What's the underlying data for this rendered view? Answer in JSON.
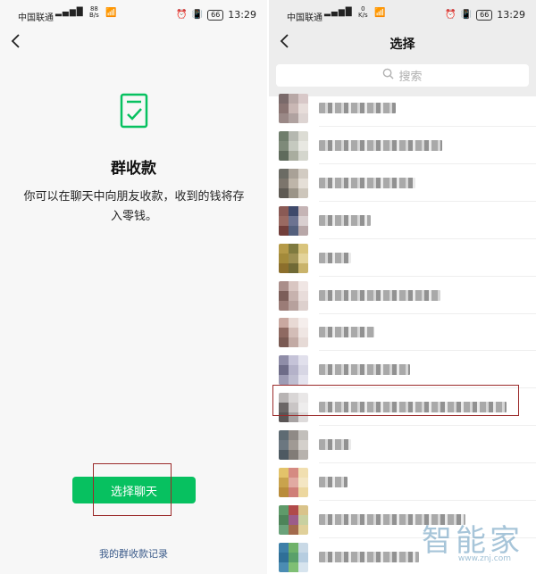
{
  "status_bar": {
    "carrier": "中国联通",
    "net_speed_left": "88",
    "net_speed_right": "0",
    "net_speed_unit": "B/s",
    "net_speed_unit_right": "K/s",
    "battery": "66",
    "time": "13:29"
  },
  "left": {
    "title": "群收款",
    "description": "你可以在聊天中向朋友收款，收到的钱将存入零钱。",
    "primary_button": "选择聊天",
    "records_link": "我的群收款记录",
    "accent_color": "#07c160"
  },
  "right": {
    "title": "选择",
    "search_placeholder": "搜索",
    "rows": [
      {
        "avatar": [
          "#7a6a6a",
          "#b8a8a6",
          "#d8c8c8",
          "#8a7472",
          "#c9b7b4",
          "#e7ddda",
          "#9a8886",
          "#b0a2a0",
          "#ddd4d2"
        ]
      },
      {
        "avatar": [
          "#6f7d6c",
          "#b5b8b0",
          "#dcdcd4",
          "#7e8a79",
          "#c5c9bf",
          "#e8e8e2",
          "#5f6b5c",
          "#a9ad9f",
          "#d4d6cd"
        ]
      },
      {
        "avatar": [
          "#6b6b64",
          "#a9a197",
          "#d2cbc2",
          "#7c756c",
          "#beb5a9",
          "#e5dfd7",
          "#5e5a53",
          "#9b9488",
          "#cdc6bb"
        ]
      },
      {
        "avatar": [
          "#8a5a55",
          "#3f4a6b",
          "#c5b4b5",
          "#9a6a62",
          "#6c7391",
          "#d9cfd0",
          "#723f3b",
          "#54607d",
          "#b8a7a8"
        ]
      },
      {
        "avatar": [
          "#b59a48",
          "#7f7a3f",
          "#d9c47c",
          "#a38a3a",
          "#9c8f52",
          "#e3d39a",
          "#8c6f2c",
          "#706a36",
          "#c9b36b"
        ]
      },
      {
        "avatar": [
          "#aa8e8a",
          "#d9c6c2",
          "#f0e6e4",
          "#7c5e59",
          "#c7b2ae",
          "#e8dcda",
          "#9b7c77",
          "#b7a19d",
          "#ddd0cd"
        ]
      },
      {
        "avatar": [
          "#c9a8a0",
          "#e8d9d4",
          "#f5eeec",
          "#8f6a62",
          "#d3bdb7",
          "#efe6e3",
          "#7a5a53",
          "#c2aaa4",
          "#e6dad6"
        ]
      },
      {
        "avatar": [
          "#8f8da8",
          "#c5c3d8",
          "#e1e0ec",
          "#6e6c88",
          "#b4b2c9",
          "#d7d6e4",
          "#9d9bb4",
          "#bebdd0",
          "#e4e3ee"
        ]
      },
      {
        "avatar": [
          "#b8b4b4",
          "#d9d6d6",
          "#e9e7e7",
          "#6b6666",
          "#c9c5c5",
          "#eeeded",
          "#5a5555",
          "#a7a2a2",
          "#dedbdb"
        ]
      },
      {
        "avatar": [
          "#5e6b73",
          "#8f8a86",
          "#c2bfbb",
          "#6b7780",
          "#a09a94",
          "#d4d0cb",
          "#4e5a62",
          "#817c77",
          "#b7b2ad"
        ]
      },
      {
        "avatar": [
          "#e3c36a",
          "#d58a82",
          "#f1dfb0",
          "#c9a34d",
          "#e1aaa2",
          "#f4e6c3",
          "#b98c3b",
          "#cf7f78",
          "#ecd79f"
        ]
      },
      {
        "avatar": [
          "#5f9a6a",
          "#b04a4a",
          "#d9c38a",
          "#4d8459",
          "#9b5c8a",
          "#c8d0a0",
          "#6aa27a",
          "#a36a4c",
          "#e0d09a"
        ]
      },
      {
        "avatar": [
          "#3d7fa8",
          "#6fb26a",
          "#c9d9e6",
          "#2f6f98",
          "#5aa06a",
          "#b6cde0",
          "#4b8cb3",
          "#7fbf74",
          "#d7e4ee"
        ]
      }
    ],
    "name_bar_widths": [
      86,
      138,
      108,
      58,
      36,
      136,
      62,
      102,
      210,
      36,
      32,
      164,
      112
    ]
  },
  "watermark": {
    "text": "智能家",
    "url": "www.znj.com"
  }
}
